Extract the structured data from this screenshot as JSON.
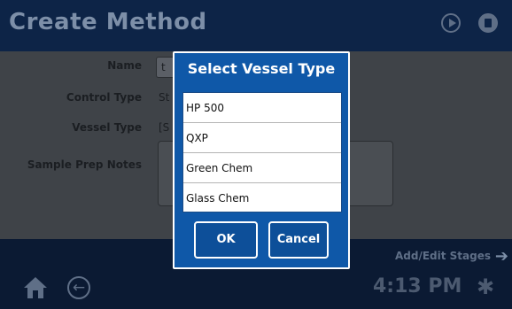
{
  "header": {
    "title": "Create Method"
  },
  "form": {
    "name_label": "Name",
    "name_value": "t",
    "control_type_label": "Control Type",
    "control_type_value": "St",
    "vessel_type_label": "Vessel Type",
    "vessel_type_value": "[S",
    "sample_prep_notes_label": "Sample Prep Notes"
  },
  "dialog": {
    "title": "Select Vessel Type",
    "items": [
      "HP 500",
      "QXP",
      "Green Chem",
      "Glass Chem"
    ],
    "ok_label": "OK",
    "cancel_label": "Cancel"
  },
  "footer": {
    "add_edit_label": "Add/Edit Stages",
    "arrow_glyph": "➔",
    "back_glyph": "←",
    "time": "4:13 PM",
    "gear_glyph": "✱"
  },
  "colors": {
    "accent": "#0f58a8",
    "header": "#0d2447",
    "form_bg": "#3f4348"
  }
}
